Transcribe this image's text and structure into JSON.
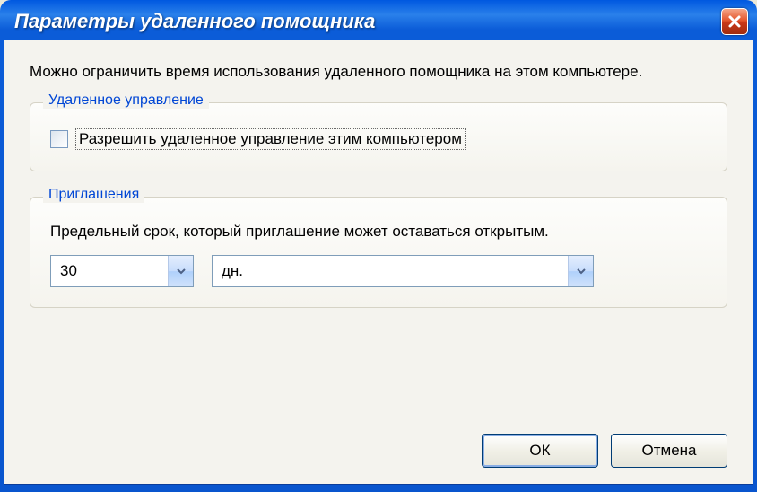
{
  "window": {
    "title": "Параметры удаленного помощника"
  },
  "intro": "Можно ограничить время использования удаленного помощника на этом компьютере.",
  "group_remote": {
    "legend": "Удаленное управление",
    "checkbox_label": "Разрешить удаленное управление этим компьютером"
  },
  "group_invite": {
    "legend": "Приглашения",
    "description": "Предельный срок, который приглашение может оставаться открытым.",
    "value_number": "30",
    "value_unit": "дн."
  },
  "buttons": {
    "ok": "ОК",
    "cancel": "Отмена"
  }
}
